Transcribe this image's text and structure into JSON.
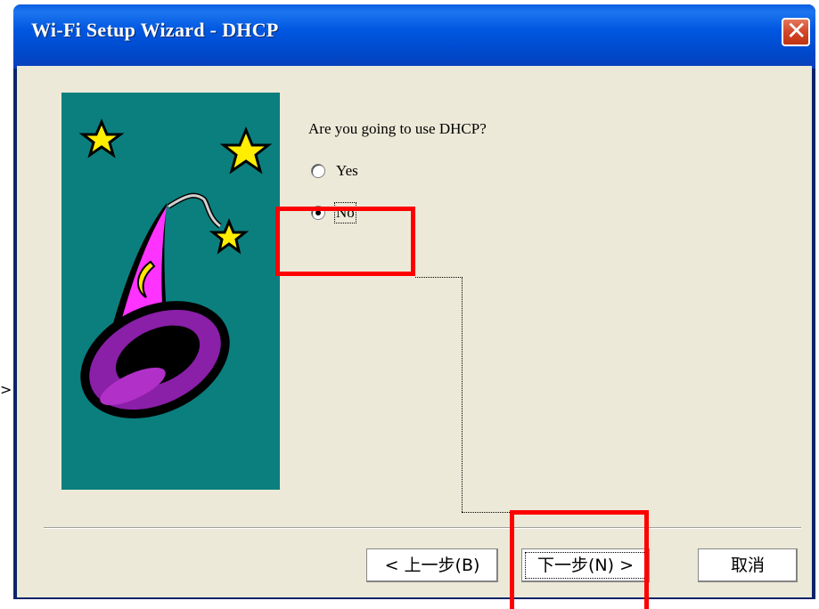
{
  "window": {
    "title": "Wi-Fi Setup Wizard - DHCP",
    "close_glyph": "✕"
  },
  "content": {
    "question": "Are you going to use DHCP?",
    "options": [
      {
        "label": "Yes",
        "selected": false
      },
      {
        "label": "No",
        "selected": true
      }
    ]
  },
  "buttons": {
    "back": "< 上一步(B)",
    "next": "下一步(N) >",
    "cancel": "取消"
  },
  "icons": {
    "illustration": "wizard-hat-illustration",
    "left_arrow": "arrow-right-icon"
  },
  "colors": {
    "title_bar": "#0055e5",
    "dialog_bg": "#ece9d8",
    "illustration_bg": "#0b7f7e",
    "highlight": "#ff0000"
  }
}
